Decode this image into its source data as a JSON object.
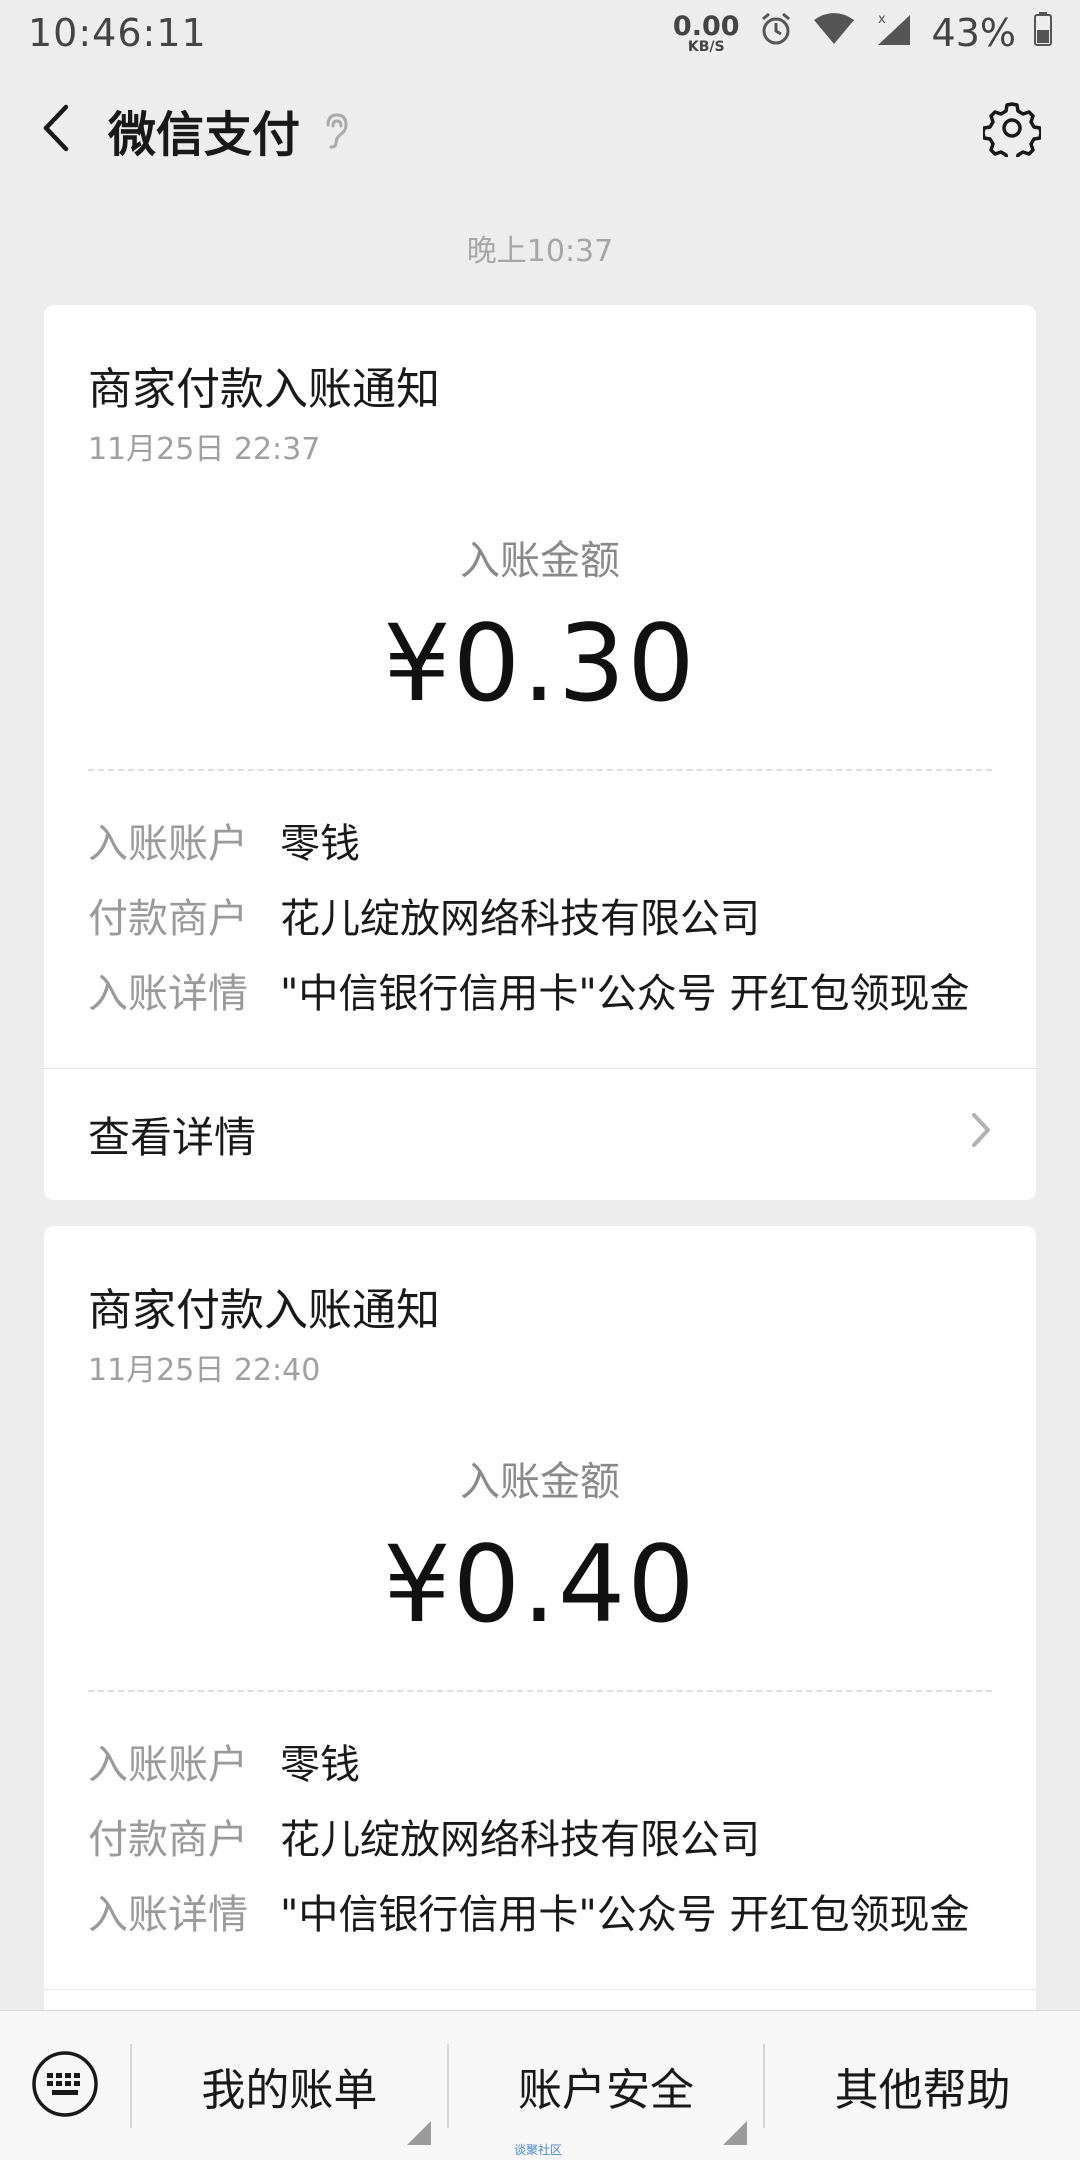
{
  "status_bar": {
    "time": "10:46:11",
    "net_speed_value": "0.00",
    "net_speed_unit": "KB/S",
    "battery": "43%"
  },
  "nav": {
    "title": "微信支付"
  },
  "time_divider": "晚上10:37",
  "cards": [
    {
      "title": "商家付款入账通知",
      "date": "11月25日  22:37",
      "amount_label": "入账金额",
      "amount": "¥0.30",
      "rows": [
        {
          "key": "入账账户",
          "value": "零钱"
        },
        {
          "key": "付款商户",
          "value": "花儿绽放网络科技有限公司"
        },
        {
          "key": "入账详情",
          "value": "\"中信银行信用卡\"公众号 开红包领现金"
        }
      ],
      "detail_link": "查看详情"
    },
    {
      "title": "商家付款入账通知",
      "date": "11月25日  22:40",
      "amount_label": "入账金额",
      "amount": "¥0.40",
      "rows": [
        {
          "key": "入账账户",
          "value": "零钱"
        },
        {
          "key": "付款商户",
          "value": "花儿绽放网络科技有限公司"
        },
        {
          "key": "入账详情",
          "value": "\"中信银行信用卡\"公众号 开红包领现金"
        }
      ]
    }
  ],
  "bottom_menu": {
    "items": [
      "我的账单",
      "账户安全",
      "其他帮助"
    ]
  },
  "watermark": "谈聚社区",
  "icons": {
    "back": "back-arrow-icon",
    "ear": "ear-icon",
    "settings": "gear-icon",
    "keyboard": "keyboard-icon",
    "chevron": "chevron-right-icon"
  }
}
